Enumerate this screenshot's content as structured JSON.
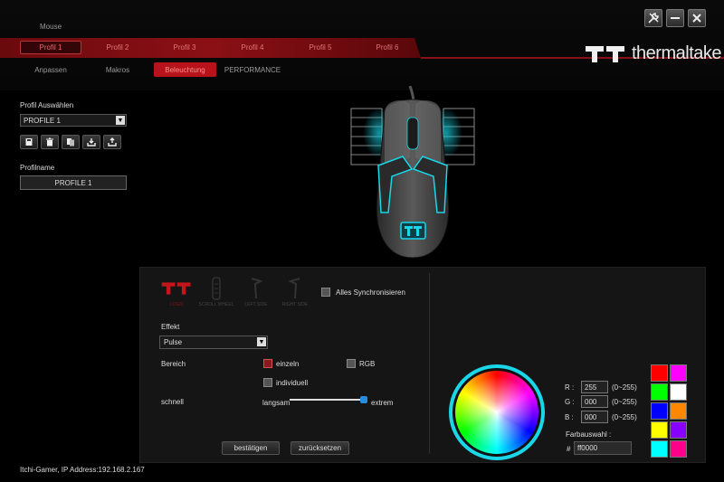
{
  "window": {
    "tab": "Mouse"
  },
  "logo": {
    "brand": "thermaltake"
  },
  "profiles": [
    "Profil 1",
    "Profil 2",
    "Profil 3",
    "Profil 4",
    "Profil 5",
    "Profil 6"
  ],
  "active_profile_index": 0,
  "subnav": [
    "Anpassen",
    "Makros",
    "Beleuchtung",
    "PERFORMANCE"
  ],
  "active_subnav_index": 2,
  "left_panel": {
    "profile_select_label": "Profil Auswählen",
    "profile_select_value": "PROFILE 1",
    "tools": [
      "save-icon",
      "delete-icon",
      "copy-icon",
      "import-icon",
      "export-icon"
    ],
    "profilename_label": "Profilname",
    "profilename_value": "PROFILE 1"
  },
  "lighting": {
    "zones": [
      {
        "label": "LOGO",
        "active": true
      },
      {
        "label": "SCROLL WHEEL",
        "active": false
      },
      {
        "label": "LEFT SIDE",
        "active": false
      },
      {
        "label": "RIGHT SIDE",
        "active": false
      }
    ],
    "sync_label": "Alles Synchronisieren",
    "effect_label": "Effekt",
    "effect_value": "Pulse",
    "area_label": "Bereich",
    "area_single": "einzeln",
    "area_rgb": "RGB",
    "area_individual": "individuell",
    "speed_label": "schnell",
    "speed_min": "langsam",
    "speed_max": "extrem",
    "speed_level": 0.95,
    "confirm_label": "bestätigen",
    "reset_label": "zurücksetzen"
  },
  "color": {
    "r_label": "R :",
    "r_value": "255",
    "g_label": "G :",
    "g_value": "000",
    "b_label": "B :",
    "b_value": "000",
    "range": "(0~255)",
    "picker_label": "Farbauswahl :",
    "hash": "#",
    "hex_value": "ff0000",
    "swatches": [
      "#ff0000",
      "#ff00ff",
      "#00ff00",
      "#ffffff",
      "#0000ff",
      "#ff8800",
      "#ffff00",
      "#8800ff",
      "#00ffff",
      "#ff0088"
    ],
    "accent_cyan": "#19d6e8",
    "brand_red": "#8b1015"
  },
  "status": "Itchi-Gamer, IP Address:192.168.2.167"
}
